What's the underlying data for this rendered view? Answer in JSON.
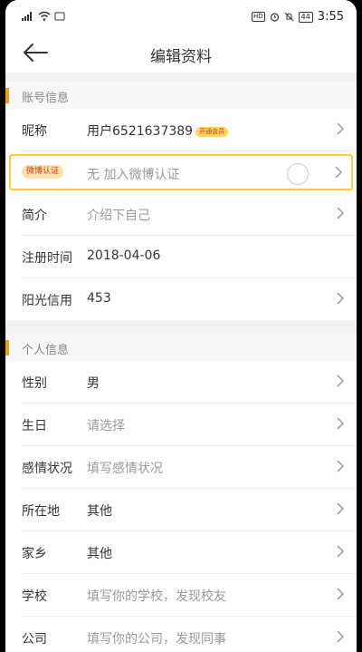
{
  "status_bar": {
    "time": "3:55",
    "hd": "HD",
    "battery": "44"
  },
  "header": {
    "title": "编辑资料"
  },
  "account_section": {
    "title": "账号信息",
    "nickname": {
      "label": "昵称",
      "value": "用户6521637389",
      "vip_tag": "开通会员"
    },
    "weibo": {
      "badge": "微博认证",
      "value": "无 加入微博认证"
    },
    "intro": {
      "label": "简介",
      "value": "介绍下自己"
    },
    "register": {
      "label": "注册时间",
      "value": "2018-04-06"
    },
    "credit": {
      "label": "阳光信用",
      "value": "453"
    }
  },
  "personal_section": {
    "title": "个人信息",
    "gender": {
      "label": "性别",
      "value": "男"
    },
    "birthday": {
      "label": "生日",
      "value": "请选择"
    },
    "relationship": {
      "label": "感情状况",
      "value": "填写感情状况"
    },
    "location": {
      "label": "所在地",
      "value": "其他"
    },
    "hometown": {
      "label": "家乡",
      "value": "其他"
    },
    "school": {
      "label": "学校",
      "value": "填写你的学校，发现校友"
    },
    "company": {
      "label": "公司",
      "value": "填写你的公司，发现同事"
    }
  },
  "colors": {
    "accent": "#f39c12",
    "highlight_border": "#ffc93c"
  }
}
